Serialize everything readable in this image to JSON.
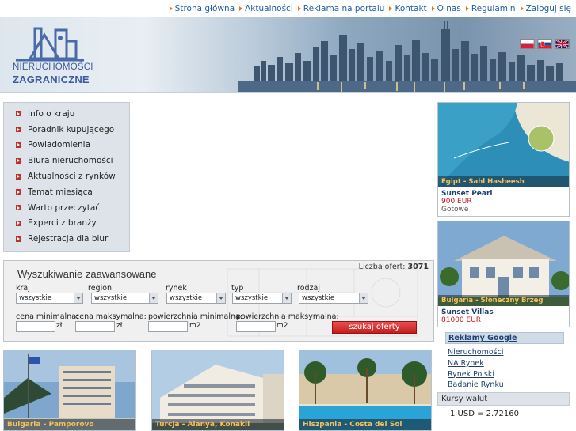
{
  "topnav": [
    {
      "label": "Strona główna"
    },
    {
      "label": "Aktualności"
    },
    {
      "label": "Reklama na portalu"
    },
    {
      "label": "Kontakt"
    },
    {
      "label": "O nas"
    },
    {
      "label": "Regulamin"
    },
    {
      "label": "Zaloguj się"
    }
  ],
  "logo": {
    "line1": "NIERUCHOMOŚCI",
    "line2": "ZAGRANICZNE"
  },
  "flags": [
    "pl-flag",
    "sk-flag",
    "uk-flag"
  ],
  "menu": [
    {
      "label": "Info o kraju"
    },
    {
      "label": "Poradnik kupującego"
    },
    {
      "label": "Powiadomienia"
    },
    {
      "label": "Biura nieruchomości"
    },
    {
      "label": "Aktualności z rynków"
    },
    {
      "label": "Temat miesiąca"
    },
    {
      "label": "Warto przeczytać"
    },
    {
      "label": "Experci z branży"
    },
    {
      "label": "Rejestracja dla biur"
    }
  ],
  "search": {
    "title": "Wyszukiwanie zaawansowane",
    "offers_label": "Liczba ofert:",
    "offers_count": "3071",
    "fields": {
      "kraj": {
        "label": "kraj",
        "value": "wszystkie"
      },
      "region": {
        "label": "region",
        "value": "wszystkie"
      },
      "rynek": {
        "label": "rynek",
        "value": "wszystkie"
      },
      "typ": {
        "label": "typ",
        "value": "wszystkie"
      },
      "rodzaj": {
        "label": "rodzaj",
        "value": "wszystkie"
      }
    },
    "price_min_label": "cena minimalna:",
    "price_max_label": "cena maksymalna:",
    "area_min_label": "powierzchnia minimalna:",
    "area_max_label": "powierzchnia maksymalna:",
    "currency": "zł",
    "area_unit": "m2",
    "button": "szukaj oferty"
  },
  "tiles": [
    {
      "caption": "Bulgaria - Pamporovo"
    },
    {
      "caption": "Turcja - Alanya, Konakli"
    },
    {
      "caption": "Hiszpania - Costa del Sol"
    }
  ],
  "offers": [
    {
      "caption": "Egipt - Sahl Hasheesh",
      "name": "Sunset Pearl",
      "price": "900 EUR",
      "status": "Gotowe"
    },
    {
      "caption": "Bulgaria - Słoneczny Brzeg",
      "name": "Sunset Villas",
      "price": "81000 EUR",
      "status": ""
    }
  ],
  "google": {
    "title": "Reklamy Google",
    "links": [
      "Nieruchomości",
      "NA Rynek",
      "Rynek Polski",
      "Badanie Rynku"
    ]
  },
  "rates": {
    "title": "Kursy walut",
    "row": "1 USD = 2.72160"
  }
}
